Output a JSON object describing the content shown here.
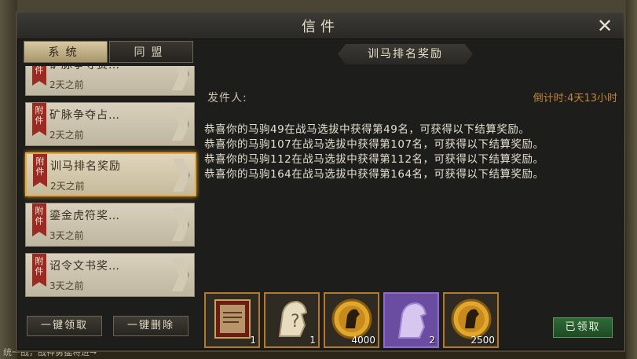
{
  "background": {
    "bottom_text": "统一战，战神勇猛将进→"
  },
  "window": {
    "title": "信件",
    "close_icon": "close-icon"
  },
  "tabs": [
    {
      "label": "系统",
      "active": true
    },
    {
      "label": "同盟",
      "active": false
    }
  ],
  "mail_list": [
    {
      "tag": "附件",
      "subject": "矿脉争夺赛…",
      "time": "2天之前",
      "selected": false
    },
    {
      "tag": "附件",
      "subject": "矿脉争夺占…",
      "time": "2天之前",
      "selected": false
    },
    {
      "tag": "附件",
      "subject": "训马排名奖励",
      "time": "2天之前",
      "selected": true
    },
    {
      "tag": "附件",
      "subject": "鎏金虎符奖…",
      "time": "3天之前",
      "selected": false
    },
    {
      "tag": "附件",
      "subject": "诏令文书奖…",
      "time": "3天之前",
      "selected": false
    }
  ],
  "buttons": {
    "claim_all": "一键领取",
    "delete_all": "一键删除"
  },
  "detail": {
    "subject": "训马排名奖励",
    "sender_label": "发件人:",
    "countdown": "倒计时:4天13小时",
    "body_lines": [
      "恭喜你的马驹49在战马选拔中获得第49名，可获得以下结算奖励。",
      "恭喜你的马驹107在战马选拔中获得第107名，可获得以下结算奖励。",
      "恭喜你的马驹112在战马选拔中获得第112名，可获得以下结算奖励。",
      "恭喜你的马驹164在战马选拔中获得第164名，可获得以下结算奖励。"
    ],
    "rewards": [
      {
        "icon": "scroll-icon",
        "count": "1",
        "rarity": "orange"
      },
      {
        "icon": "mystery-horse-icon",
        "count": "1",
        "rarity": "orange"
      },
      {
        "icon": "horse-coin-icon",
        "count": "4000",
        "rarity": "orange"
      },
      {
        "icon": "purple-horse-icon",
        "count": "2",
        "rarity": "purple"
      },
      {
        "icon": "horse-coin-icon",
        "count": "2500",
        "rarity": "orange"
      }
    ],
    "claimed_label": "已领取"
  },
  "colors": {
    "accent_gold": "#e7a640",
    "tag_red": "#9a2a22",
    "countdown": "#c4843a",
    "claimed_green": "#2f6a37",
    "purple_rarity": "#6a4ca1"
  }
}
